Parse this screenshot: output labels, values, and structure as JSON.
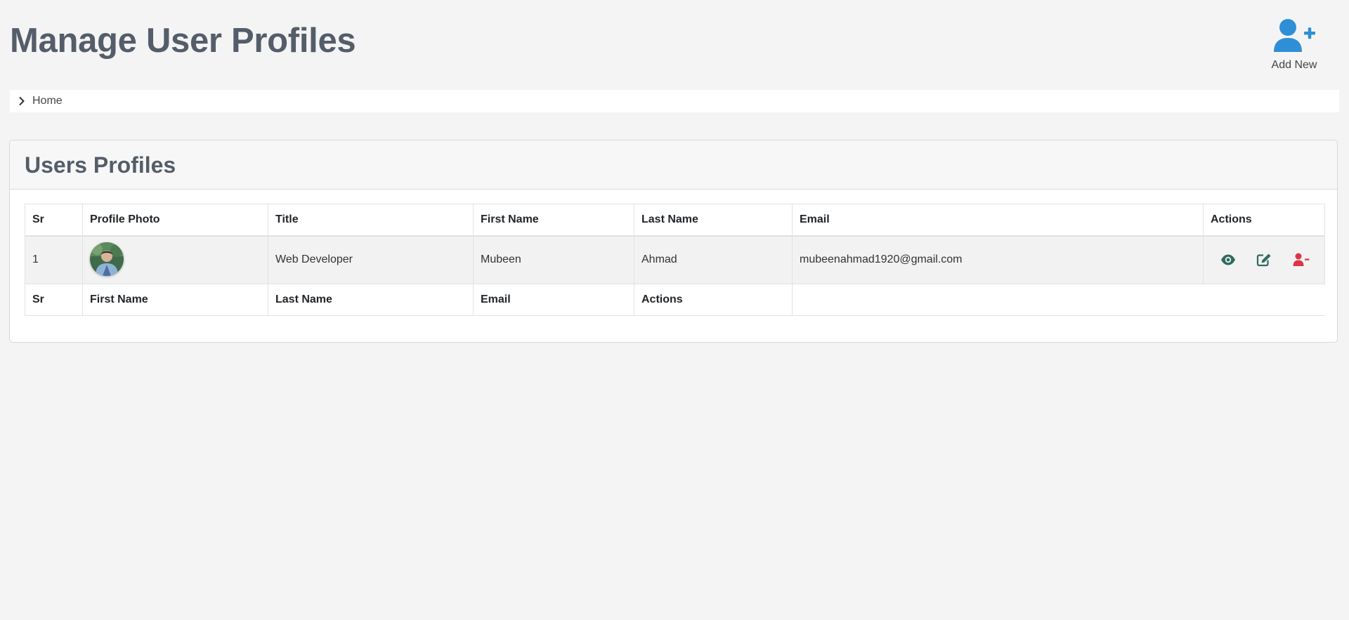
{
  "header": {
    "title": "Manage User Profiles",
    "add_new_label": "Add New",
    "add_new_icon": "user-plus-icon",
    "accent_color": "#2f8fd6"
  },
  "breadcrumb": {
    "items": [
      {
        "label": "Home",
        "icon": "chevron-right-icon"
      }
    ]
  },
  "card": {
    "title": "Users Profiles"
  },
  "table": {
    "header_columns": [
      "Sr",
      "Profile Photo",
      "Title",
      "First Name",
      "Last Name",
      "Email",
      "Actions"
    ],
    "rows": [
      {
        "sr": "1",
        "photo": "avatar",
        "title": "Web Developer",
        "first_name": "Mubeen",
        "last_name": "Ahmad",
        "email": "mubeenahmad1920@gmail.com",
        "actions": [
          {
            "name": "view",
            "icon": "eye-icon",
            "color": "#2e6b5e"
          },
          {
            "name": "edit",
            "icon": "edit-icon",
            "color": "#2e6b5e"
          },
          {
            "name": "delete",
            "icon": "user-minus-icon",
            "color": "#dc3545"
          }
        ]
      }
    ],
    "footer_columns": [
      "Sr",
      "First Name",
      "Last Name",
      "Email",
      "Actions"
    ]
  }
}
